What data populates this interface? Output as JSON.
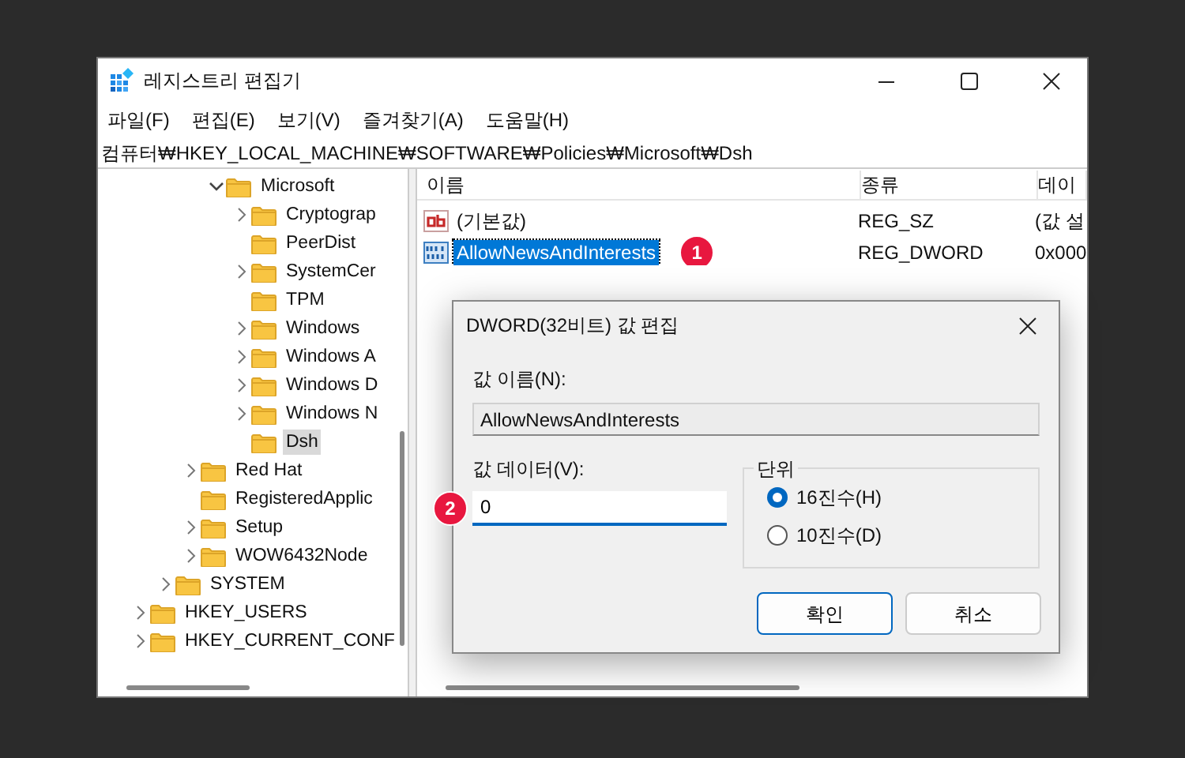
{
  "window": {
    "title": "레지스트리 편집기"
  },
  "menu": [
    "파일(F)",
    "편집(E)",
    "보기(V)",
    "즐겨찾기(A)",
    "도움말(H)"
  ],
  "address": "컴퓨터₩HKEY_LOCAL_MACHINE₩SOFTWARE₩Policies₩Microsoft₩Dsh",
  "tree": [
    {
      "children": [
        {
          "children": [
            {
              "children": [
                {
                  "label": "Microsoft",
                  "expanded": true,
                  "selected": false,
                  "children": [
                    {
                      "label": "Cryptograp",
                      "expanded": false,
                      "selected": false
                    },
                    {
                      "label": "PeerDist",
                      "selected": false
                    },
                    {
                      "label": "SystemCer",
                      "expanded": false,
                      "selected": false
                    },
                    {
                      "label": "TPM",
                      "selected": false
                    },
                    {
                      "label": "Windows",
                      "expanded": false,
                      "selected": false
                    },
                    {
                      "label": "Windows A",
                      "expanded": false,
                      "selected": false
                    },
                    {
                      "label": "Windows D",
                      "expanded": false,
                      "selected": false
                    },
                    {
                      "label": "Windows N",
                      "expanded": false,
                      "selected": false
                    },
                    {
                      "label": "Dsh",
                      "selected": true
                    }
                  ]
                }
              ]
            },
            {
              "label": "Red Hat",
              "expanded": false,
              "selected": false
            },
            {
              "label": "RegisteredApplic",
              "selected": false
            },
            {
              "label": "Setup",
              "expanded": false,
              "selected": false
            },
            {
              "label": "WOW6432Node",
              "expanded": false,
              "selected": false
            }
          ]
        },
        {
          "label": "SYSTEM",
          "expanded": false,
          "selected": false
        }
      ]
    },
    {
      "label": "HKEY_USERS",
      "expanded": false,
      "selected": false
    },
    {
      "label": "HKEY_CURRENT_CONF",
      "expanded": false,
      "selected": false
    }
  ],
  "values": {
    "columns": [
      "이름",
      "종류",
      "데이"
    ],
    "rows": [
      {
        "kind": "string",
        "name": "(기본값)",
        "type": "REG_SZ",
        "data": "(값 설",
        "selected": false
      },
      {
        "kind": "dword",
        "name": "AllowNewsAndInterests",
        "type": "REG_DWORD",
        "data": "0x000",
        "selected": true,
        "callout": "1"
      }
    ]
  },
  "dialog": {
    "title": "DWORD(32비트) 값 편집",
    "name_label": "값 이름(N):",
    "name_value": "AllowNewsAndInterests",
    "data_label": "값 데이터(V):",
    "data_value": "0",
    "data_callout": "2",
    "base_label": "단위",
    "bases": [
      {
        "label": "16진수(H)",
        "selected": true
      },
      {
        "label": "10진수(D)",
        "selected": false
      }
    ],
    "buttons": [
      {
        "label": "확인",
        "primary": true
      },
      {
        "label": "취소",
        "primary": false
      }
    ]
  }
}
